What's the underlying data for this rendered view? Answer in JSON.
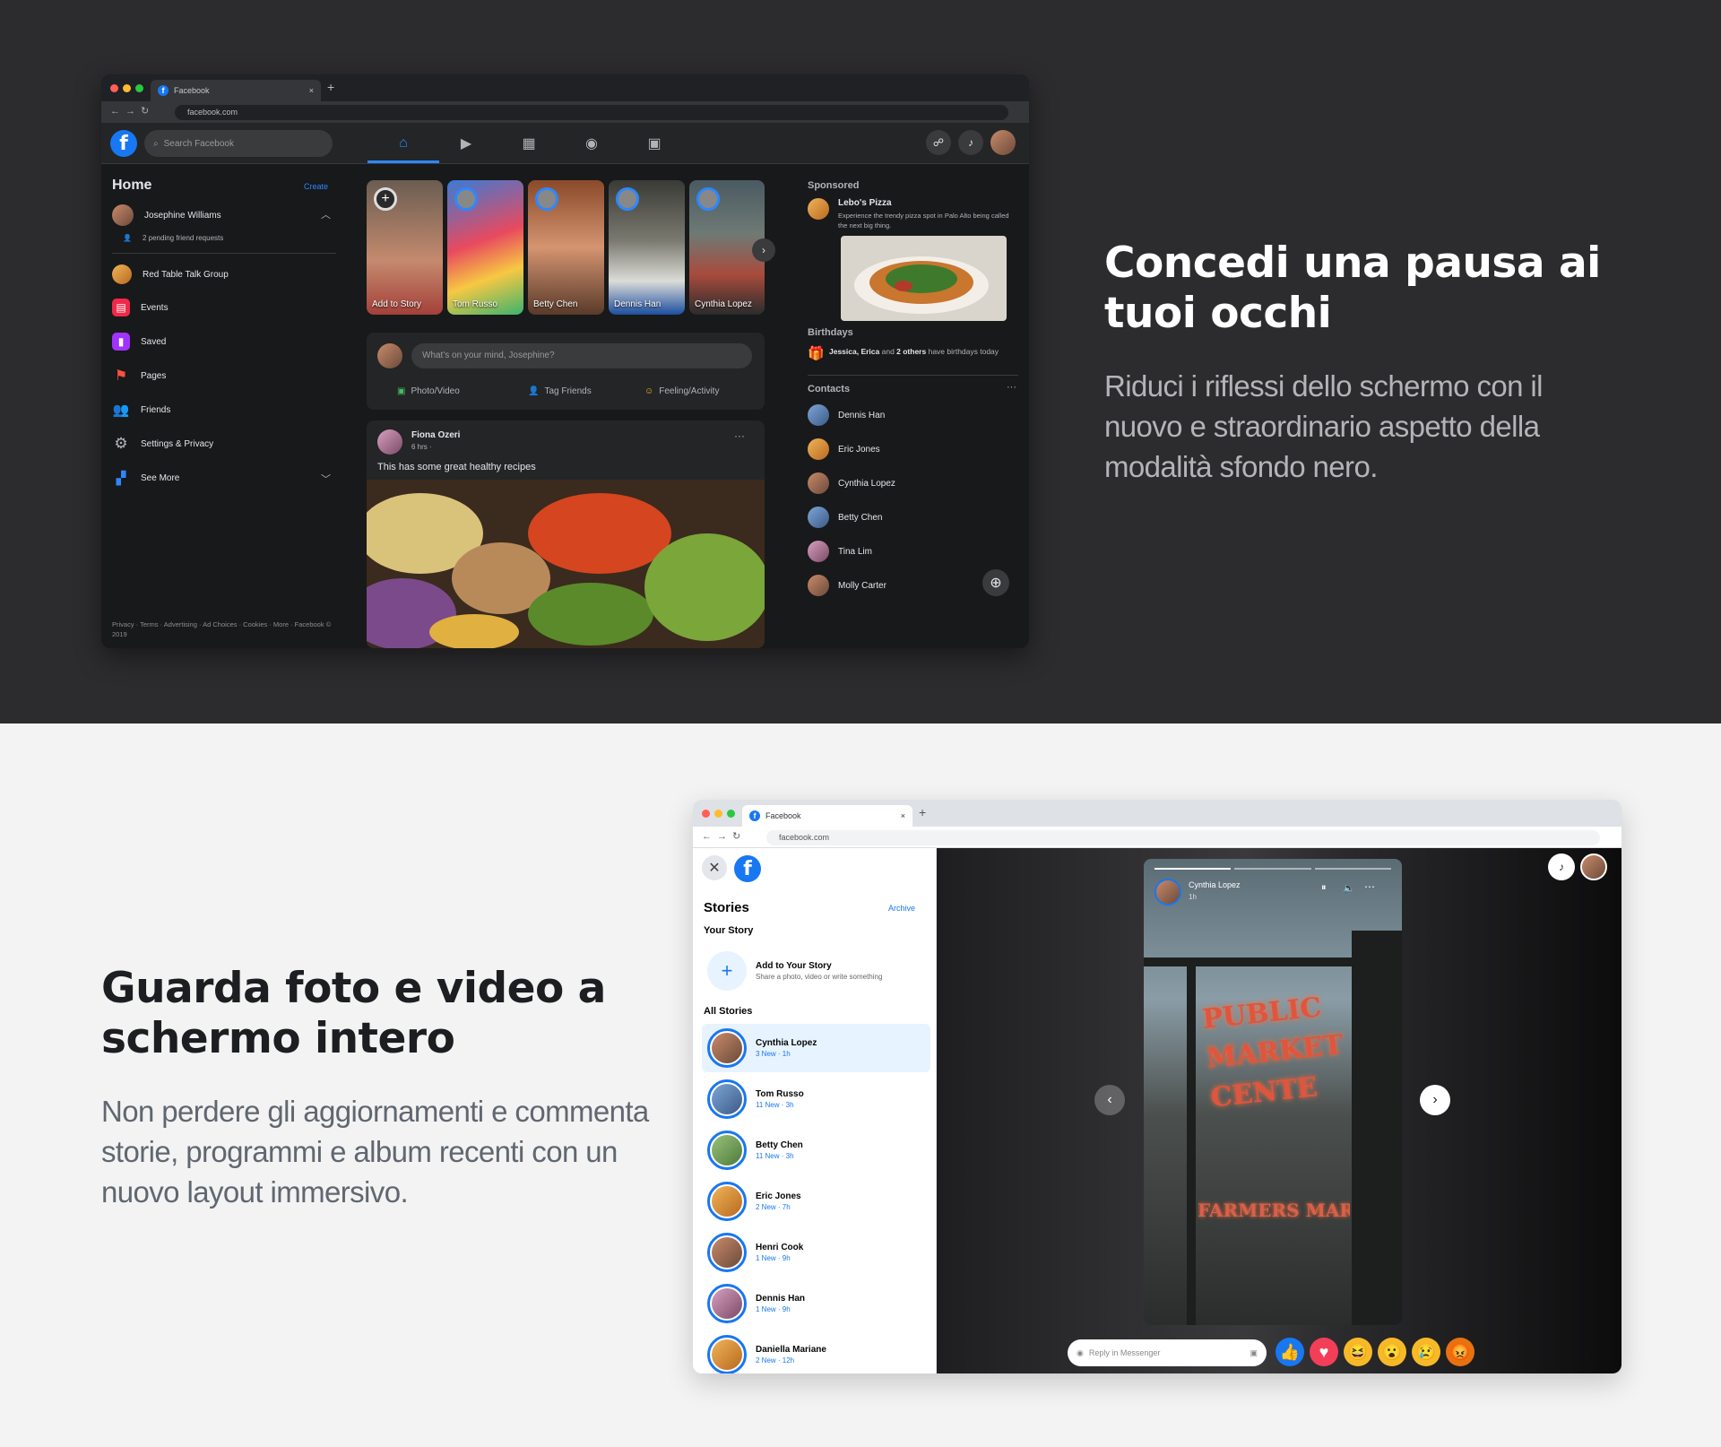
{
  "top": {
    "heading": "Concedi una pausa ai tuoi occhi",
    "body": "Riduci i riflessi dello schermo con il nuovo e straordinario aspetto della modalità sfondo nero."
  },
  "bottom": {
    "heading": "Guarda foto e video a schermo intero",
    "body": "Non perdere gli aggiornamenti e commenta storie, programmi e album recenti con un nuovo layout immersivo."
  },
  "dark_window": {
    "tab_title": "Facebook",
    "url": "facebook.com",
    "search_placeholder": "Search Facebook",
    "left": {
      "title": "Home",
      "create": "Create",
      "user": "Josephine Williams",
      "friend_requests": "2 pending friend requests",
      "items": [
        "Red Table Talk Group",
        "Events",
        "Saved",
        "Pages",
        "Friends",
        "Settings & Privacy",
        "See More"
      ],
      "footer": "Privacy · Terms · Advertising · Ad Choices · Cookies · More · Facebook © 2019"
    },
    "stories": [
      "Add to Story",
      "Tom Russo",
      "Betty Chen",
      "Dennis Han",
      "Cynthia Lopez"
    ],
    "composer": {
      "placeholder": "What's on your mind, Josephine?",
      "actions": [
        "Photo/Video",
        "Tag Friends",
        "Feeling/Activity"
      ]
    },
    "post": {
      "author": "Fiona Ozeri",
      "time": "6 hrs · ",
      "text": "This has some great healthy recipes"
    },
    "right": {
      "sponsored_label": "Sponsored",
      "ad_name": "Lebo's Pizza",
      "ad_text": "Experience the trendy pizza spot in Palo Alto being called the next big thing.",
      "birthdays_label": "Birthdays",
      "birthday_names": "Jessica, Erica",
      "birthday_and": " and ",
      "birthday_others": "2 others",
      "birthday_rest": " have birthdays today",
      "contacts_label": "Contacts",
      "contacts": [
        "Dennis Han",
        "Eric Jones",
        "Cynthia Lopez",
        "Betty Chen",
        "Tina Lim",
        "Molly Carter"
      ]
    }
  },
  "light_window": {
    "tab_title": "Facebook",
    "url": "facebook.com",
    "stories_title": "Stories",
    "archive": "Archive",
    "your_story": "Your Story",
    "add_title": "Add to Your Story",
    "add_sub": "Share a photo, video or write something",
    "all_stories": "All Stories",
    "stories": [
      {
        "name": "Cynthia Lopez",
        "sub": "3 New · 1h"
      },
      {
        "name": "Tom Russo",
        "sub": "11 New · 3h"
      },
      {
        "name": "Betty Chen",
        "sub": "11 New · 3h"
      },
      {
        "name": "Eric Jones",
        "sub": "2 New · 7h"
      },
      {
        "name": "Henri Cook",
        "sub": "1 New · 9h"
      },
      {
        "name": "Dennis Han",
        "sub": "1 New · 9h"
      },
      {
        "name": "Daniella Mariane",
        "sub": "2 New · 12h"
      }
    ],
    "viewer": {
      "author": "Cynthia Lopez",
      "time": "1h",
      "sign": "PUBLIC MARKET CENTE",
      "sign2": "FARMERS MARK",
      "reply_placeholder": "Reply in Messenger"
    }
  }
}
